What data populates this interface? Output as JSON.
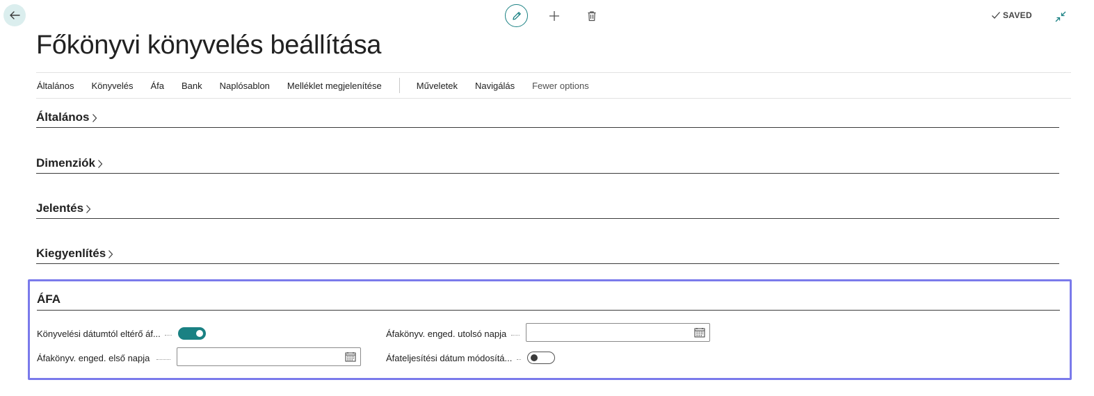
{
  "page": {
    "title": "Főkönyvi könyvelés beállítása",
    "status": "SAVED"
  },
  "icons": {
    "back": "arrow-left-icon",
    "edit": "pencil-icon",
    "add": "plus-icon",
    "delete": "trash-icon",
    "saved": "checkmark-icon",
    "collapse": "collapse-arrows-icon",
    "calendar": "calendar-icon",
    "chevron": "chevron-right-icon"
  },
  "colors": {
    "accent": "#1a8183",
    "focus_outline": "#7a7aeb",
    "back_button_bg": "#dbeeee"
  },
  "action_bar": {
    "items": [
      "Általános",
      "Könyvelés",
      "Áfa",
      "Bank",
      "Naplósablon",
      "Melléklet megjelenítése"
    ],
    "items_after_separator": [
      "Műveletek",
      "Navigálás"
    ],
    "fewer_options": "Fewer options"
  },
  "sections": {
    "general": "Általános",
    "dimensions": "Dimenziók",
    "reporting": "Jelentés",
    "reconciliation": "Kiegyenlítés"
  },
  "vat_section": {
    "title": "ÁFA",
    "fields": {
      "posting_date_toggle": {
        "label": "Könyvelési dátumtól eltérő áf...",
        "value": true
      },
      "first_day": {
        "label": "Áfakönyv. enged. első napja",
        "value": ""
      },
      "last_day": {
        "label": "Áfakönyv. enged. utolsó napja",
        "value": ""
      },
      "modify_date_toggle": {
        "label": "Áfateljesítési dátum módosítá...",
        "value": false
      }
    }
  }
}
